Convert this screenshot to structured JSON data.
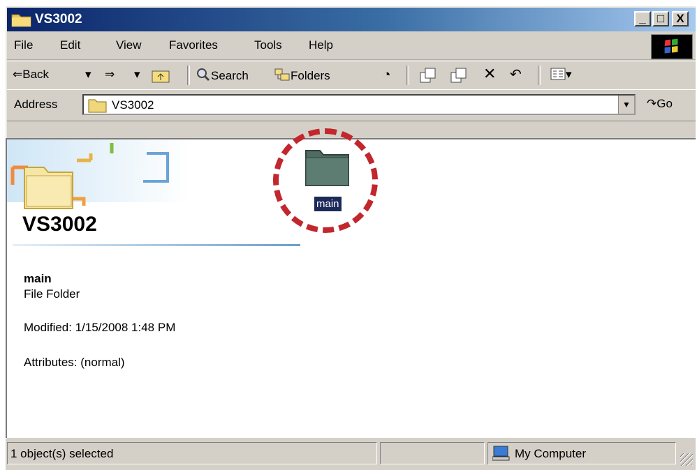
{
  "window": {
    "title": "VS3002",
    "controls": {
      "minimize": "_",
      "maximize": "□",
      "close": "X"
    }
  },
  "menu": [
    "File",
    "Edit",
    "View",
    "Favorites",
    "Tools",
    "Help"
  ],
  "toolbar": {
    "back_label": "Back",
    "search_label": "Search",
    "folders_label": "Folders",
    "icons": [
      "back-arrow-icon",
      "forward-arrow-icon",
      "up-folder-icon",
      "search-icon",
      "folders-icon",
      "history-icon",
      "move-to-icon",
      "copy-to-icon",
      "delete-icon",
      "undo-icon",
      "views-icon"
    ]
  },
  "address": {
    "label": "Address",
    "value": "VS3002",
    "go_label": "Go"
  },
  "content": {
    "banner_title": "VS3002",
    "selected_name": "main",
    "selected_type": "File Folder",
    "modified": "Modified: 1/15/2008 1:48 PM",
    "attributes": "Attributes: (normal)",
    "folder_item_label": "main"
  },
  "status": {
    "selection": "1 object(s) selected",
    "zone": "My Computer"
  },
  "colors": {
    "title_gradient_start": "#0a246a",
    "title_gradient_end": "#a6caf0",
    "highlight_circle": "#c1272d",
    "selection_bg": "#1c2a5a"
  }
}
